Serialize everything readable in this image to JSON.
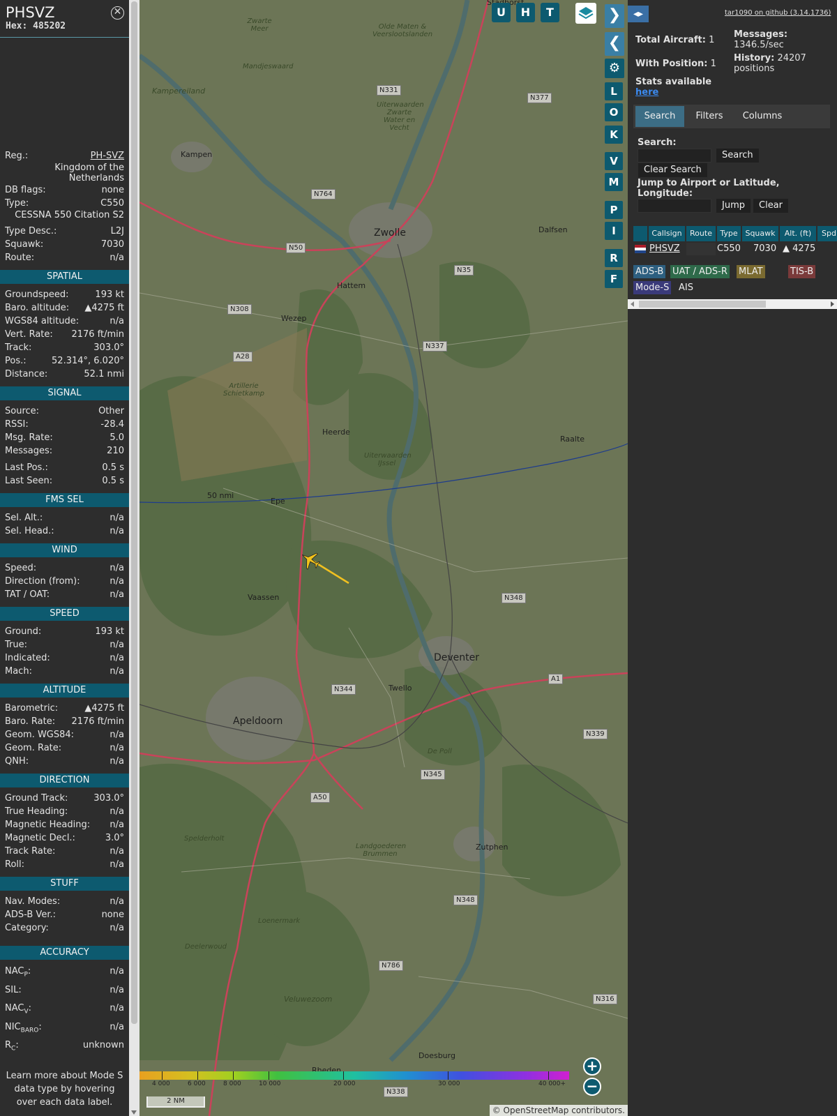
{
  "aircraft": {
    "callsign": "PHSVZ",
    "hex_label": "Hex:",
    "hex": "485202",
    "close_icon": "close-circle-icon"
  },
  "details": [
    {
      "label": "Reg.:",
      "value": "PH-SVZ",
      "link": true
    },
    {
      "country": "Kingdom of the Netherlands"
    },
    {
      "label": "DB flags:",
      "value": "none"
    },
    {
      "label": "Type:",
      "value": "C550"
    },
    {
      "model": "CESSNA 550 Citation S2"
    },
    {
      "label": "Type Desc.:",
      "value": "L2J"
    },
    {
      "label": "Squawk:",
      "value": "7030"
    },
    {
      "label": "Route:",
      "value": "n/a"
    }
  ],
  "sections": [
    {
      "title": "SPATIAL",
      "rows": [
        [
          "Groundspeed:",
          "193 kt"
        ],
        [
          "Baro. altitude:",
          "▲4275 ft"
        ],
        [
          "WGS84 altitude:",
          "n/a"
        ],
        [
          "Vert. Rate:",
          "2176 ft/min"
        ],
        [
          "Track:",
          "303.0°"
        ],
        [
          "Pos.:",
          "52.314°, 6.020°"
        ],
        [
          "Distance:",
          "52.1 nmi"
        ]
      ]
    },
    {
      "title": "SIGNAL",
      "rows": [
        [
          "Source:",
          "Other"
        ],
        [
          "RSSI:",
          "-28.4"
        ],
        [
          "Msg. Rate:",
          "5.0"
        ],
        [
          "Messages:",
          "210"
        ],
        [
          "Last Pos.:",
          "0.5 s"
        ],
        [
          "Last Seen:",
          "0.5 s"
        ]
      ]
    },
    {
      "title": "FMS SEL",
      "rows": [
        [
          "Sel. Alt.:",
          "n/a"
        ],
        [
          "Sel. Head.:",
          "n/a"
        ]
      ]
    },
    {
      "title": "WIND",
      "rows": [
        [
          "Speed:",
          "n/a"
        ],
        [
          "Direction (from):",
          "n/a"
        ],
        [
          "TAT / OAT:",
          "n/a"
        ]
      ]
    },
    {
      "title": "SPEED",
      "rows": [
        [
          "Ground:",
          "193 kt"
        ],
        [
          "True:",
          "n/a"
        ],
        [
          "Indicated:",
          "n/a"
        ],
        [
          "Mach:",
          "n/a"
        ]
      ]
    },
    {
      "title": "ALTITUDE",
      "rows": [
        [
          "Barometric:",
          "▲4275 ft"
        ],
        [
          "Baro. Rate:",
          "2176 ft/min"
        ],
        [
          "Geom. WGS84:",
          "n/a"
        ],
        [
          "Geom. Rate:",
          "n/a"
        ],
        [
          "QNH:",
          "n/a"
        ]
      ]
    },
    {
      "title": "DIRECTION",
      "rows": [
        [
          "Ground Track:",
          "303.0°"
        ],
        [
          "True Heading:",
          "n/a"
        ],
        [
          "Magnetic Heading:",
          "n/a"
        ],
        [
          "Magnetic Decl.:",
          "3.0°"
        ],
        [
          "Track Rate:",
          "n/a"
        ],
        [
          "Roll:",
          "n/a"
        ]
      ]
    },
    {
      "title": "STUFF",
      "rows": [
        [
          "Nav. Modes:",
          "n/a"
        ],
        [
          "ADS-B Ver.:",
          "none"
        ],
        [
          "Category:",
          "n/a"
        ]
      ]
    }
  ],
  "accuracy": {
    "title": "ACCURACY",
    "rows": [
      {
        "base": "NAC",
        "sub": "P",
        "tail": ":",
        "value": "n/a"
      },
      {
        "base": "SIL:",
        "sub": "",
        "tail": "",
        "value": "n/a"
      },
      {
        "base": "NAC",
        "sub": "V",
        "tail": ":",
        "value": "n/a"
      },
      {
        "base": "NIC",
        "sub": "BARO",
        "tail": ":",
        "value": "n/a"
      },
      {
        "base": "R",
        "sub": "C",
        "tail": ":",
        "value": "unknown"
      }
    ]
  },
  "footer": "Learn more about Mode S data type by hovering over each data label.",
  "map": {
    "top_buttons": [
      "U",
      "H",
      "T"
    ],
    "side_buttons": [
      "L",
      "O",
      "K",
      "V",
      "M",
      "P",
      "I",
      "R",
      "F"
    ],
    "range_ring_label": "50 nmi",
    "scale_label": "2 NM",
    "attribution": "© OpenStreetMap contributors.",
    "altitude_legend": [
      "4 000",
      "6 000",
      "8 000",
      "10 000",
      "20 000",
      "30 000",
      "40 000+"
    ],
    "places": {
      "zwolle": "Zwolle",
      "deventer": "Deventer",
      "apeldoorn": "Apeldoorn",
      "hattem": "Hattem",
      "wezep": "Wezep",
      "heerde": "Heerde",
      "epe": "Epe",
      "vaassen": "Vaassen",
      "twello": "Twello",
      "zutphen": "Zutphen",
      "kampen": "Kampen",
      "dalfsen": "Dalfsen",
      "raalte": "Raalte",
      "doesburg": "Doesburg",
      "rheden": "Rheden",
      "mandjeswaard": "Mandjeswaard",
      "kampereiland": "Kampereiland",
      "artillerie": "Artillerie Schietkamp",
      "veluwezoom": "Veluwezoom",
      "loenermark": "Loenermark",
      "spelderholt": "Spelderholt",
      "deelerwoud": "Deelerwoud",
      "landgoederen": "Landgoederen Brummen",
      "depoll": "De Poll",
      "uiterwaarden_ijssel": "Uiterwaarden IJssel",
      "zwarte_meer": "Zwarte Meer",
      "oldemater": "Olde Maten & Veerslootslanden",
      "uiterwaarden_zwarte": "Uiterwaarden Zwarte Water en Vecht",
      "stadhorst": "Stadhorst"
    },
    "roads": {
      "n331": "N331",
      "n377": "N377",
      "n764": "N764",
      "n50": "N50",
      "n35": "N35",
      "n308": "N308",
      "n337": "N337",
      "a28": "A28",
      "n348": "N348",
      "n344": "N344",
      "a1": "A1",
      "n339": "N339",
      "n345": "N345",
      "a50": "A50",
      "n786": "N786",
      "n316": "N316",
      "n338": "N338",
      "n348b": "N348"
    },
    "colors": {
      "route": "#c9435a",
      "track": "#f0c020",
      "aircraft": "#f2c31a",
      "ring": "#1e3c8c"
    }
  },
  "right": {
    "github_link": "tar1090 on github (3.14.1736)",
    "total_aircraft_label": "Total Aircraft:",
    "total_aircraft": "1",
    "with_position_label": "With Position:",
    "with_position": "1",
    "messages_label": "Messages:",
    "messages": "1346.5/sec",
    "history_label": "History:",
    "history": "24207 positions",
    "stats_label": "Stats available",
    "stats_link": "here",
    "tabs": [
      "Search",
      "Filters",
      "Columns"
    ],
    "search_label": "Search:",
    "search_button": "Search",
    "clear_search_button": "Clear Search",
    "jump_label": "Jump to Airport or Latitude, Longitude:",
    "jump_button": "Jump",
    "clear_button": "Clear",
    "table_headers": [
      "Callsign",
      "Route",
      "Type",
      "Squawk",
      "Alt. (ft)",
      "Spd"
    ],
    "table_row": {
      "callsign": "PHSVZ",
      "route": "",
      "type": "C550",
      "squawk": "7030",
      "alt": "▲ 4275"
    },
    "source_tags": [
      {
        "label": "ADS-B",
        "color": "#2d5f80"
      },
      {
        "label": "UAT / ADS-R",
        "color": "#2e6a4a"
      },
      {
        "label": "MLAT",
        "color": "#7a6a30"
      },
      {
        "label": "TIS-B",
        "color": "#7a3a3a"
      },
      {
        "label": "Mode-S",
        "color": "#3a3a7a"
      },
      {
        "label": "AIS",
        "color": "#2d2d2d"
      }
    ]
  }
}
